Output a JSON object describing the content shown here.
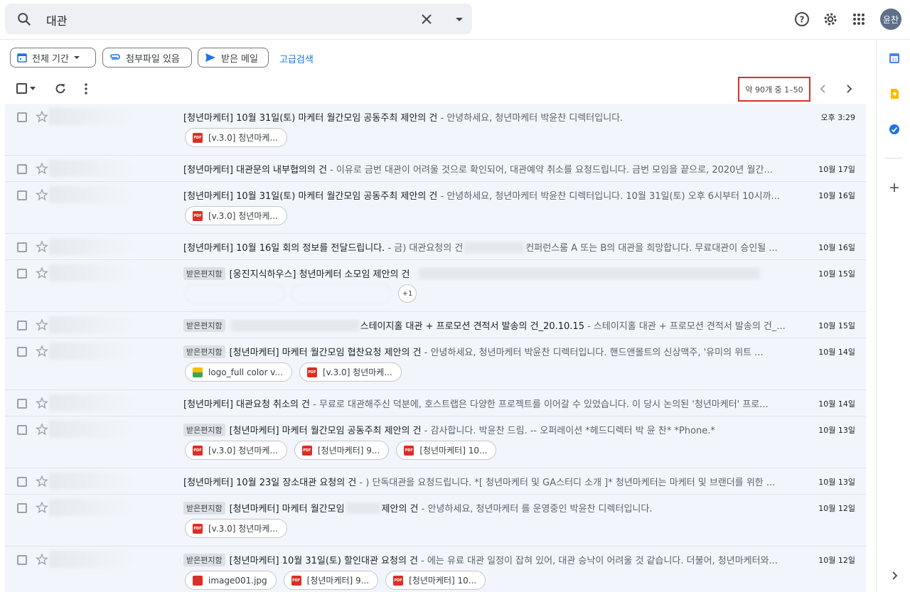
{
  "search": {
    "query": "대관"
  },
  "user": {
    "avatar_text": "윤찬"
  },
  "filters": {
    "period": "전체 기간",
    "attachment": "첨부파일 있음",
    "received": "받은 메일",
    "advanced": "고급검색"
  },
  "pagination": {
    "count": "약 90개 중 1–50"
  },
  "colors": {
    "highlight_box": "#d93025",
    "row_bg": "#f2f6fc",
    "accent": "#1a73e8"
  },
  "emails": [
    {
      "label": "",
      "subject": "[청년마케터] 10월 31일(토) 마케터 월간모임 공동주최 제안의 건",
      "snippet": " - 안녕하세요, 청년마케터 박윤찬 디렉터입니다.",
      "date": "오후 3:29",
      "attachments": [
        "[v.3.0] 청년마케..."
      ]
    },
    {
      "label": "",
      "subject": "[청년마케터] 대관문의 내부협의의 건",
      "snippet": " - 이유로 금번 대관이 어려울 것으로 확인되어, 대관예약 취소를 요청드립니다. 금번 모임을 끝으로, 2020년 월간...",
      "date": "10월 17일",
      "attachments": []
    },
    {
      "label": "",
      "subject": "[청년마케터] 10월 31일(토) 마케터 월간모임 공동주최 제안의 건",
      "snippet": " - 안녕하세요, 청년마케터 박윤찬 디렉터입니다. 10월 31일(토) 오후 6시부터 10시까...",
      "date": "10월 16일",
      "attachments": [
        "[v.3.0] 청년마케..."
      ]
    },
    {
      "label": "",
      "subject": "[청년마케터] 10월 16일 회의 정보를 전달드립니다.",
      "snippet": " - 금) 대관요청의 건",
      "snippet2": "컨퍼런스룸 A 또는 B의 대관을 희망합니다. 무료대관이 승인될 ...",
      "date": "10월 16일",
      "attachments": []
    },
    {
      "label": "받은편지함",
      "subject": "[웅진지식하우스] 청년마케터 소모임 제안의 건",
      "snippet": "",
      "date": "10월 15일",
      "attachments": [],
      "more": "+1"
    },
    {
      "label": "받은편지함",
      "subject": "스테이지홀 대관 + 프로모션 견적서 발송의 건_20.10.15",
      "snippet": " - 스테이지홀 대관 + 프로모션 견적서 발송의 건_...",
      "date": "10월 15일",
      "attachments": []
    },
    {
      "label": "받은편지함",
      "subject": "[청년마케터] 마케터 월간모임 협찬요청 제안의 건",
      "snippet": " - 안녕하세요, 청년마케터 박윤찬 디렉터입니다. 핸드앤몰트의 신상맥주, '유미의 위트 ...",
      "date": "10월 14일",
      "attachments": [
        "logo_full color v...",
        "[v.3.0] 청년마케..."
      ]
    },
    {
      "label": "",
      "subject": "[청년마케터] 대관요청 취소의 건",
      "snippet": " - 무료로 대관해주신 덕분에, 호스트랩은 다양한 프로젝트를 이어갈 수 있었습니다. 이 당시 논의된 '청년마케터' 프로...",
      "date": "10월 14일",
      "attachments": []
    },
    {
      "label": "받은편지함",
      "subject": "[청년마케터] 마케터 월간모임 공동주최 제안의 건",
      "snippet": " - 감사합니다. 박윤찬 드림. -- 오퍼레이션 *헤드디렉터 박 윤 찬* *Phone.*",
      "date": "10월 13일",
      "attachments": [
        "[v.3.0] 청년마케...",
        "[청년마케터] 9...",
        "[청년마케터] 10..."
      ]
    },
    {
      "label": "",
      "subject": "[청년마케터] 10월 23일 장소대관 요청의 건",
      "snippet": " - ) 단독대관을 요청드립니다. *[ 청년마케터 및 GA스터디 소개 ]* 청년마케터는 마케터 및 브랜더를 위한 ...",
      "date": "10월 13일",
      "attachments": []
    },
    {
      "label": "받은편지함",
      "subject": "[청년마케터] 마케터 월간모임",
      "subject2": "제안의 건",
      "snippet": " - 안녕하세요, 청년마케터 를 운영중인 박윤찬 디렉터입니다.",
      "date": "10월 12일",
      "attachments": [
        "[v.3.0] 청년마케..."
      ]
    },
    {
      "label": "받은편지함",
      "subject": "[청년마케터] 10월 31일(토) 할인대관 요청의 건",
      "snippet": " - 에는 유료 대관 일정이 잡혀 있어, 대관 승낙이 어려울 것 같습니다. 더불어, 청년마케터와...",
      "date": "10월 12일",
      "attachments": [
        "image001.jpg",
        "[청년마케터] 9...",
        "[청년마케터] 10..."
      ]
    }
  ]
}
